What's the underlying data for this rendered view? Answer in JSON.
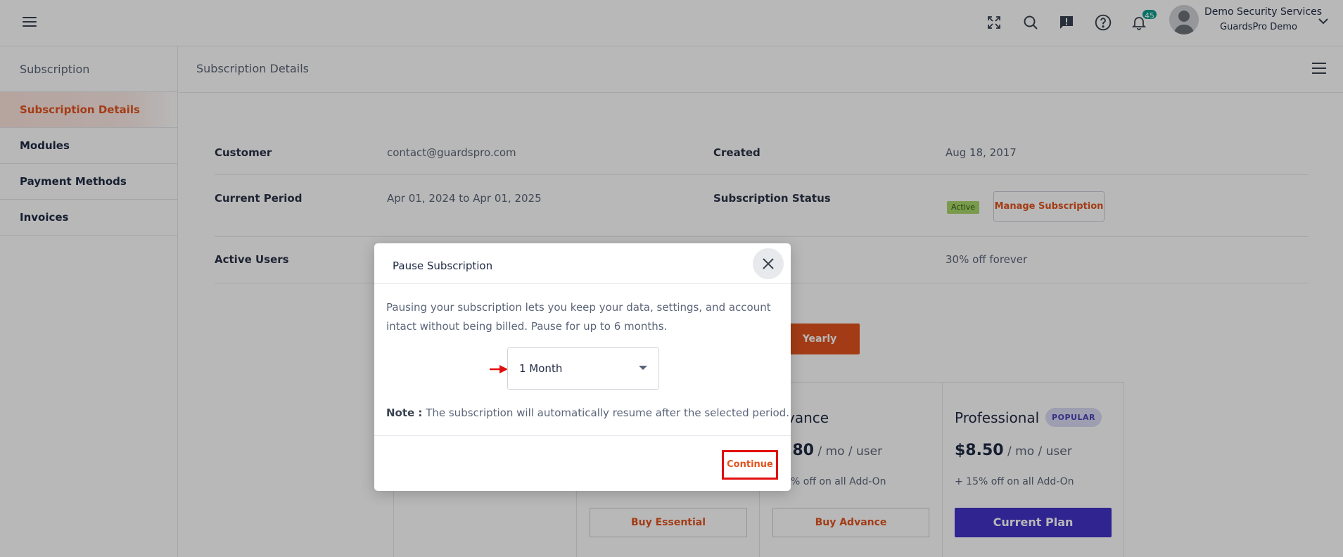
{
  "topbar": {
    "icons": [
      "fullscreen-icon",
      "search-icon",
      "feedback-icon",
      "help-icon",
      "bell-icon"
    ],
    "notifications_count": "45",
    "user": {
      "name": "Demo Security Services",
      "company": "GuardsPro Demo"
    }
  },
  "sidebar": {
    "title": "Subscription",
    "items": [
      {
        "label": "Subscription Details",
        "active": true
      },
      {
        "label": "Modules",
        "active": false
      },
      {
        "label": "Payment Methods",
        "active": false
      },
      {
        "label": "Invoices",
        "active": false
      }
    ]
  },
  "main": {
    "title": "Subscription Details",
    "details": {
      "customer_label": "Customer",
      "customer_value": "contact@guardspro.com",
      "created_label": "Created",
      "created_value": "Aug 18, 2017",
      "period_label": "Current Period",
      "period_value": "Apr 01, 2024 to Apr 01, 2025",
      "status_label": "Subscription Status",
      "status_value": "Active",
      "manage_button": "Manage Subscription",
      "users_label": "Active Users",
      "discount_value": "30% off forever"
    },
    "billing_toggle": "Yearly",
    "plans": [
      {
        "name": "",
        "price": "",
        "unit": "",
        "addon": "",
        "button": "Buy Essential"
      },
      {
        "name": "vance",
        "price": ".80",
        "unit": " / mo / user",
        "addon": "% off on all Add-On",
        "button": "Buy Advance"
      },
      {
        "name": "Professional",
        "badge": "POPULAR",
        "price": "$8.50",
        "unit": " / mo / user",
        "addon": "+ 15% off on all Add-On",
        "button": "Current Plan"
      }
    ]
  },
  "modal": {
    "title": "Pause Subscription",
    "description": "Pausing your subscription lets you keep your data, settings, and account intact without being billed. Pause for up to 6 months.",
    "duration_selected": "1 Month",
    "note_label": "Note :",
    "note_text": " The subscription will automatically resume after the selected period.",
    "continue_button": "Continue"
  },
  "colors": {
    "accent": "#e2541f",
    "primary_button": "#4233c8",
    "active_badge": "#a9d66b",
    "notification_badge": "#0f9b8e",
    "highlight_box": "#e10e0e"
  }
}
